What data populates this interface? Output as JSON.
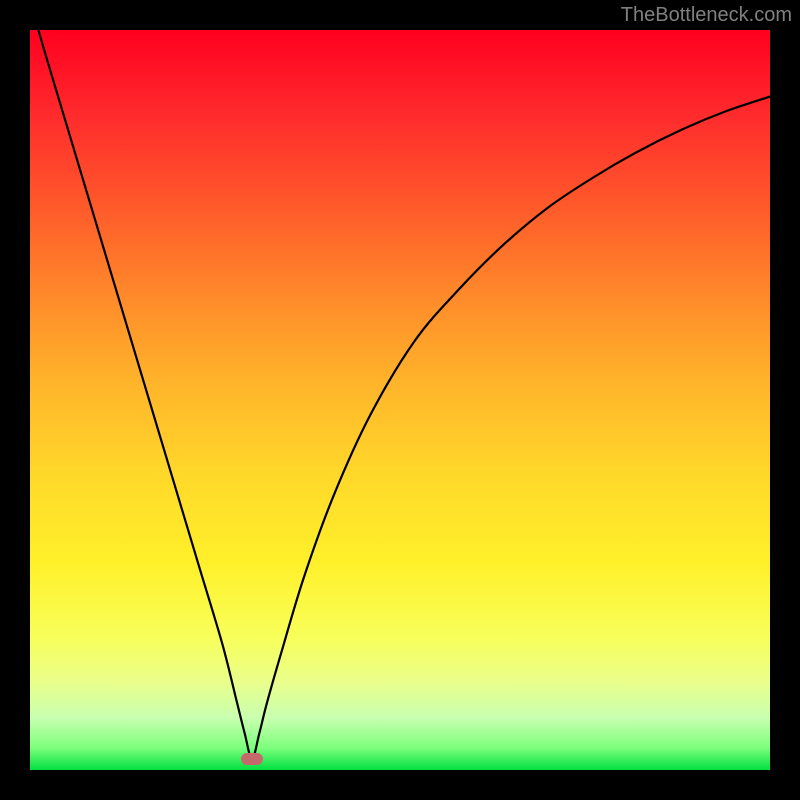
{
  "watermark": "TheBottleneck.com",
  "chart_data": {
    "type": "line",
    "title": "",
    "xlabel": "",
    "ylabel": "",
    "xlim": [
      0,
      100
    ],
    "ylim": [
      0,
      100
    ],
    "grid": false,
    "legend": false,
    "background": "rainbow-gradient",
    "marker": {
      "x": 30,
      "y": 1.5,
      "color": "#c46a6a"
    },
    "series": [
      {
        "name": "curve",
        "color": "#000000",
        "x": [
          0,
          2,
          5,
          8,
          11,
          14,
          17,
          20,
          23,
          26,
          28,
          29,
          30,
          31,
          32,
          34,
          37,
          41,
          46,
          52,
          58,
          64,
          70,
          76,
          82,
          88,
          94,
          100
        ],
        "values": [
          104,
          97,
          87,
          77,
          67,
          57,
          47,
          37,
          27,
          17,
          9,
          5,
          1.5,
          5,
          9,
          16,
          26,
          37,
          48,
          58,
          65,
          71,
          76,
          80,
          83.5,
          86.5,
          89,
          91
        ]
      }
    ]
  }
}
